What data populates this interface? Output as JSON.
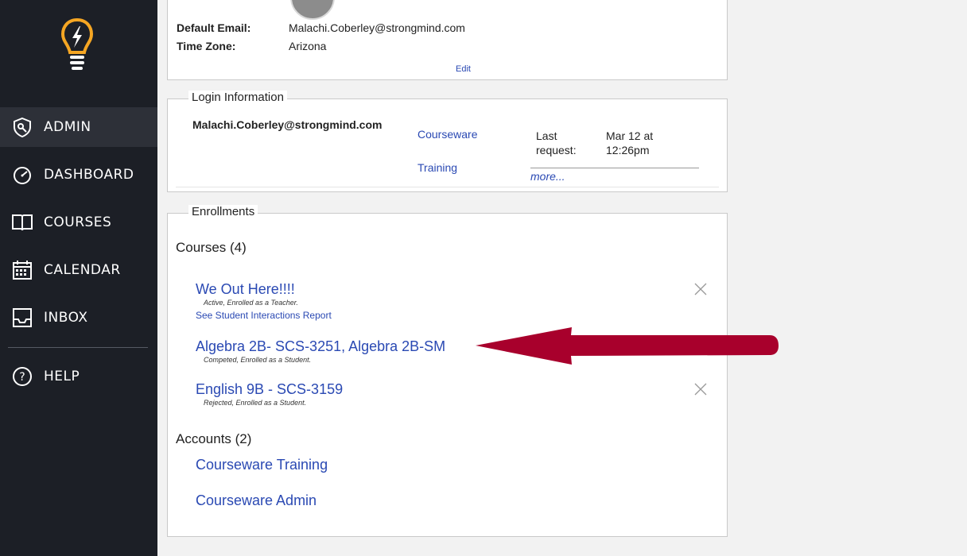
{
  "sidebar": {
    "items": [
      {
        "label": "ADMIN",
        "icon": "admin-shield-icon",
        "active": true
      },
      {
        "label": "DASHBOARD",
        "icon": "speedometer-icon",
        "active": false
      },
      {
        "label": "COURSES",
        "icon": "book-icon",
        "active": false
      },
      {
        "label": "CALENDAR",
        "icon": "calendar-icon",
        "active": false
      },
      {
        "label": "INBOX",
        "icon": "inbox-tray-icon",
        "active": false
      },
      {
        "label": "HELP",
        "icon": "help-question-icon",
        "active": false
      }
    ],
    "colors": {
      "bg": "#1c1f26",
      "active_bg": "#2d3038",
      "logo_accent": "#f5a623"
    }
  },
  "profile": {
    "default_email_label": "Default Email:",
    "default_email_value": "Malachi.Coberley@strongmind.com",
    "time_zone_label": "Time Zone:",
    "time_zone_value": "Arizona",
    "edit_label": "Edit"
  },
  "login": {
    "legend": "Login Information",
    "username": "Malachi.Coberley@strongmind.com",
    "links": [
      "Courseware",
      "Training"
    ],
    "last_request_label": "Last request:",
    "last_request_value": "Mar 12 at 12:26pm",
    "more_label": "more..."
  },
  "enrollments": {
    "legend": "Enrollments",
    "courses_heading": "Courses (4)",
    "courses": [
      {
        "title": "We Out Here!!!!",
        "status": "Active, Enrolled as a Teacher.",
        "removable": true,
        "extra_link": "See Student Interactions Report"
      },
      {
        "title": "Algebra 2B- SCS-3251, Algebra 2B-SM",
        "status": "Competed, Enrolled as a Student.",
        "removable": false
      },
      {
        "title": "English 9B - SCS-3159",
        "status": "Rejected, Enrolled as a Student.",
        "removable": true
      }
    ],
    "accounts_heading": "Accounts (2)",
    "accounts": [
      "Courseware Training",
      "Courseware Admin"
    ]
  },
  "annotation": {
    "arrow_color": "#a8002c"
  }
}
